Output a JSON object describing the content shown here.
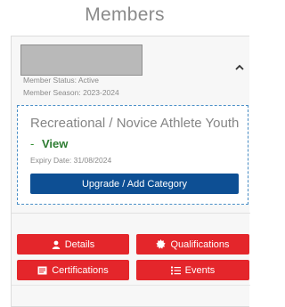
{
  "page": {
    "title": "Members"
  },
  "member": {
    "status_line": "Member Status: Active",
    "season_line": "Member Season: 2023-2024"
  },
  "category": {
    "name": "Recreational / Novice Athlete Youth",
    "view_dash": "-",
    "view_label": "View",
    "expiry_line": "Expiry Date: 31/08/2024",
    "upgrade_label": "Upgrade / Add Category"
  },
  "actions": {
    "details_label": "Details",
    "qualifications_label": "Qualifications",
    "certifications_label": "Certifications",
    "events_label": "Events"
  },
  "icons": {
    "collapse": "chevron-up-icon",
    "details": "user-icon",
    "qualifications": "badge-icon",
    "certifications": "certificate-icon",
    "events": "list-icon"
  },
  "colors": {
    "primary_button": "#0d4f94",
    "action_button": "#e4262b",
    "view_link": "#2e7d32",
    "dashed_border": "#4a8fc7"
  }
}
